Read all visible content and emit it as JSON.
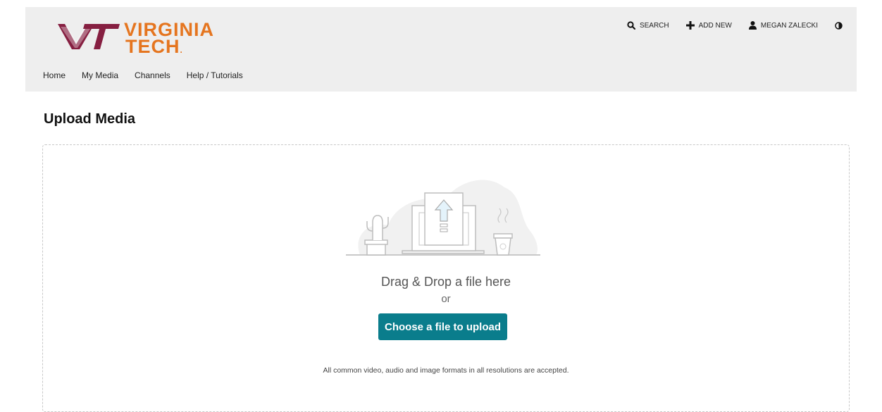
{
  "brand": {
    "line1": "VIRGINIA",
    "line2": "TECH",
    "dot": ".",
    "color": "#e5751f",
    "mark_color": "#861f41"
  },
  "nav": [
    {
      "label": "Home"
    },
    {
      "label": "My Media"
    },
    {
      "label": "Channels"
    },
    {
      "label": "Help / Tutorials"
    }
  ],
  "actions": {
    "search": {
      "label": "SEARCH",
      "icon": "search-icon"
    },
    "add_new": {
      "label": "ADD NEW",
      "icon": "plus-icon"
    },
    "user": {
      "label": "MEGAN ZALECKI",
      "icon": "user-icon"
    },
    "contrast": {
      "icon": "contrast-icon"
    }
  },
  "page": {
    "title": "Upload Media"
  },
  "upload": {
    "drag_text": "Drag & Drop a file here",
    "or_text": "or",
    "button_label": "Choose a file to upload",
    "formats_note": "All common video, audio and image formats in all resolutions are accepted."
  },
  "colors": {
    "button": "#0a7d8c",
    "header_bg": "#eeeeee"
  }
}
